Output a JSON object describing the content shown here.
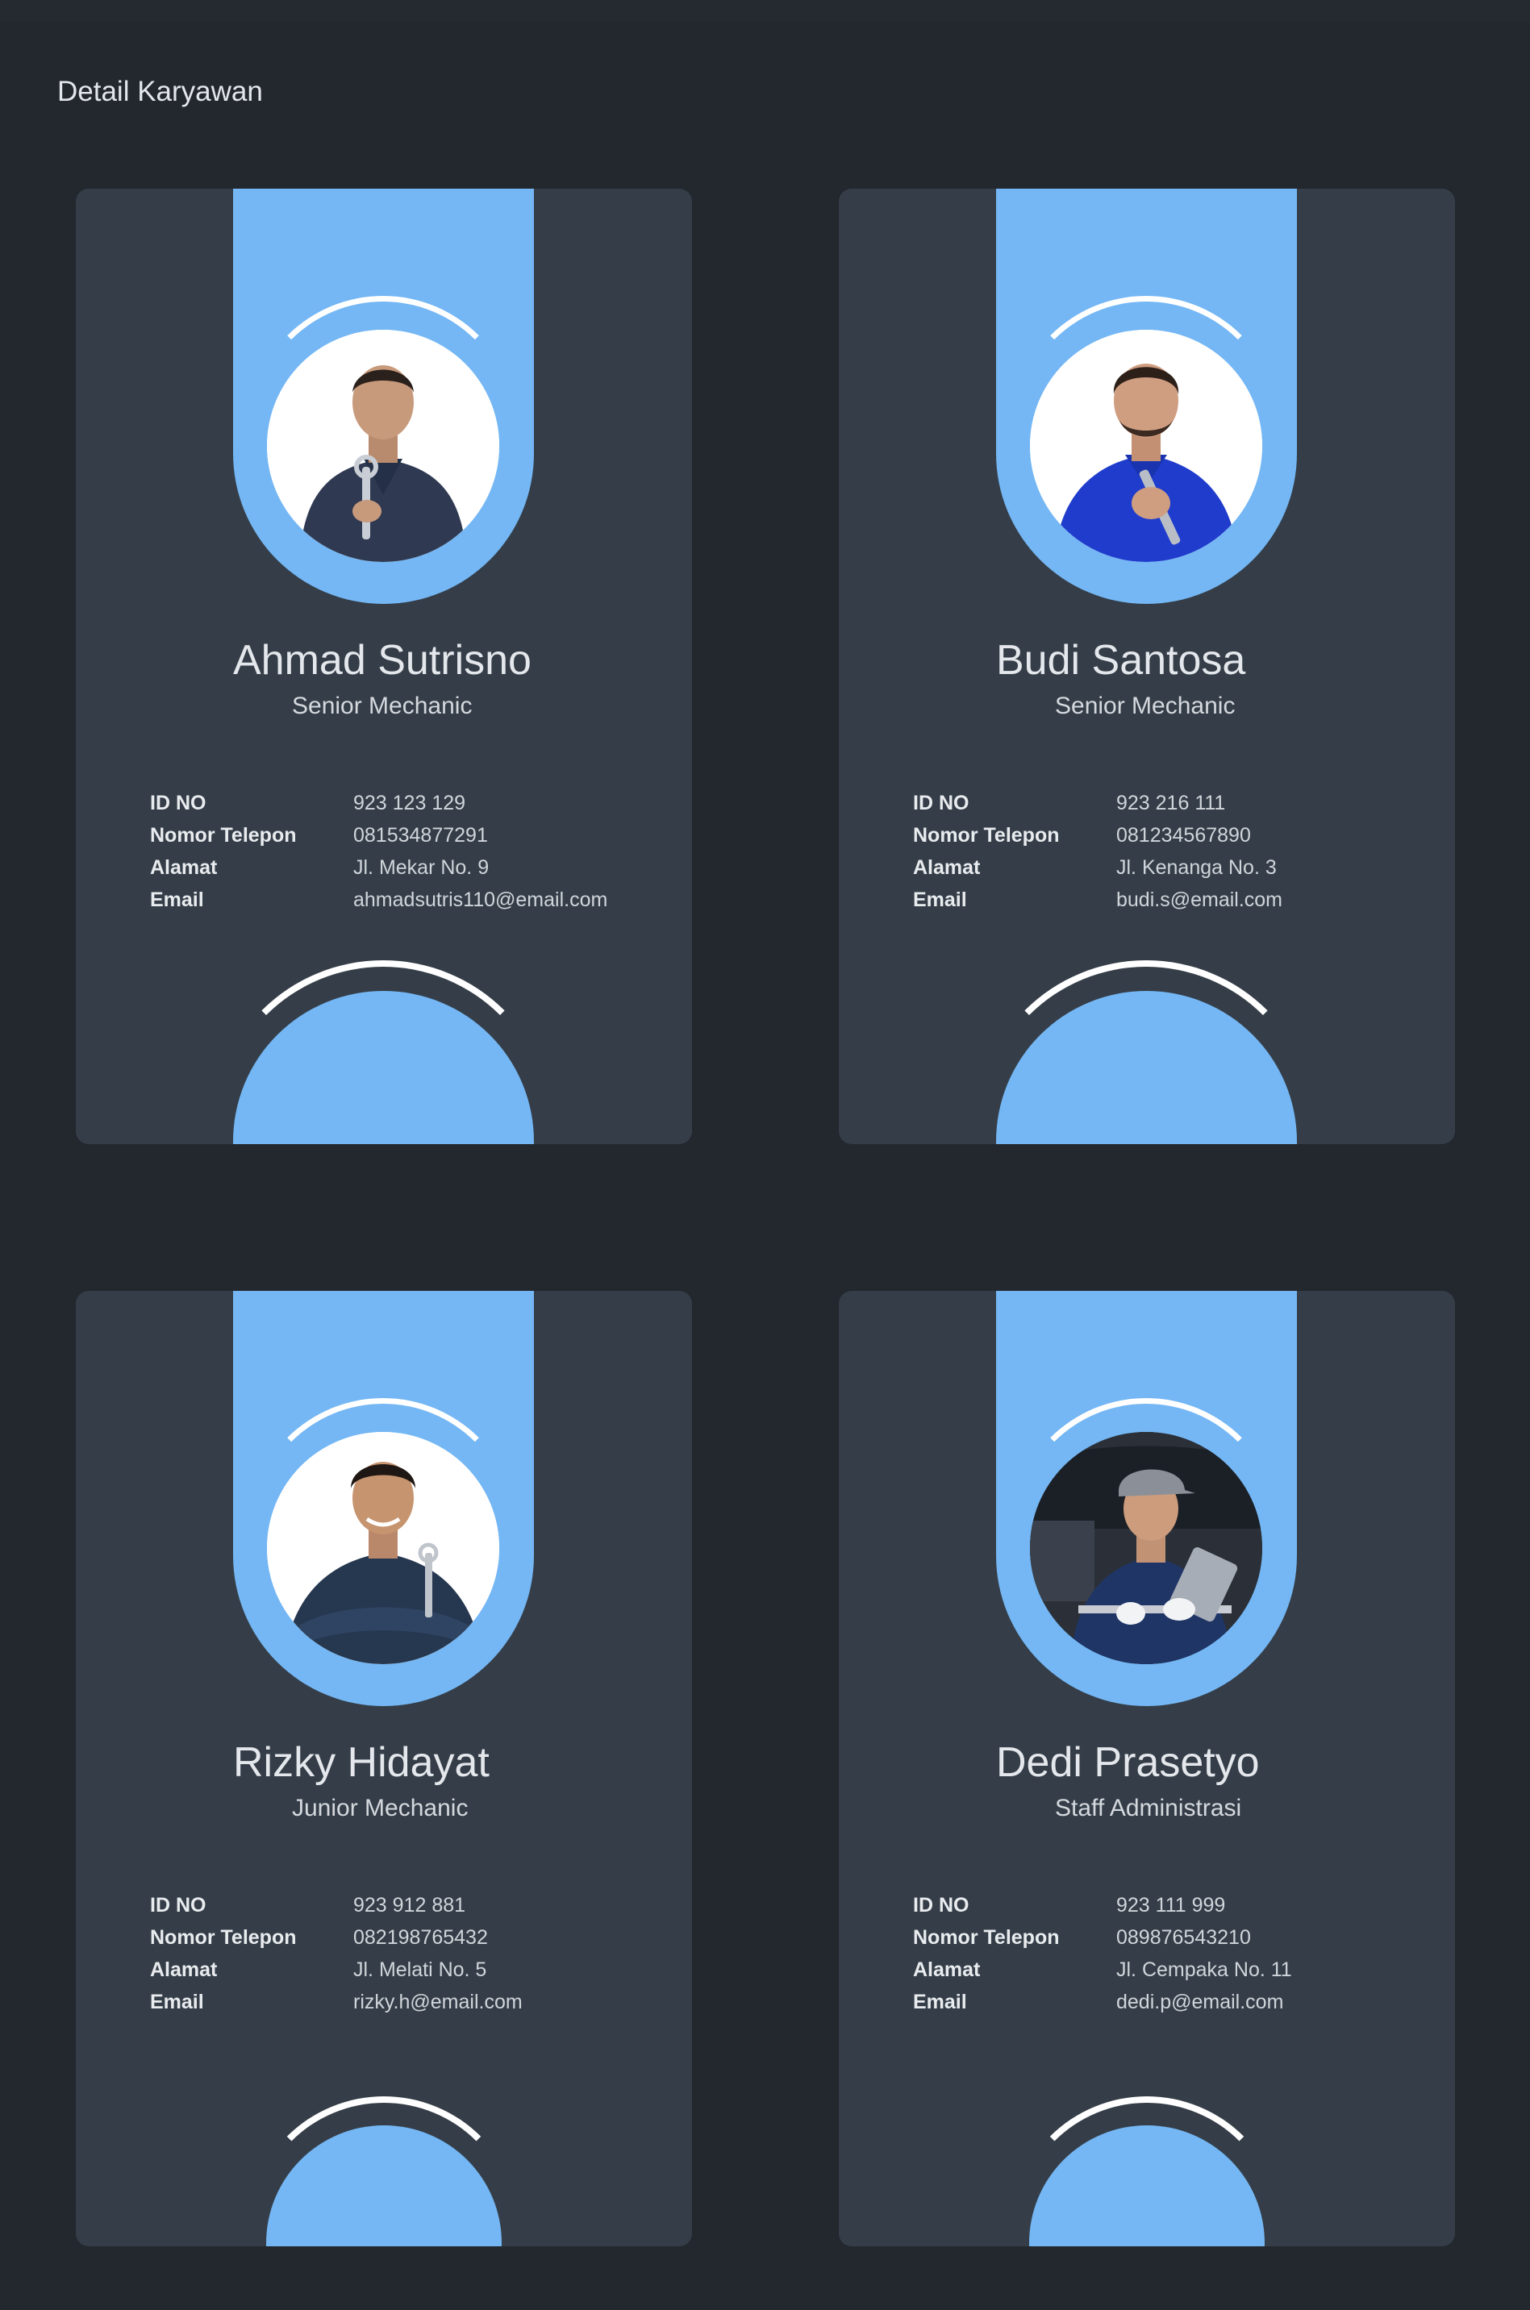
{
  "page": {
    "title": "Detail Karyawan"
  },
  "colors": {
    "background": "#23272e",
    "card": "#353e48",
    "accent": "#74b7f4",
    "arc": "#ffffff"
  },
  "labels": {
    "id": "ID NO",
    "phone": "Nomor Telepon",
    "address": "Alamat",
    "email": "Email"
  },
  "employees": [
    {
      "name": "Ahmad Sutrisno",
      "role": "Senior Mechanic",
      "id": "923 123 129",
      "phone": "081534877291",
      "address": "Jl. Mekar No. 9",
      "email": "ahmadsutris110@email.com",
      "photo_icon": "mechanic-holding-wrench-photo"
    },
    {
      "name": "Budi Santosa",
      "role": "Senior Mechanic",
      "id": "923 216 111",
      "phone": "081234567890",
      "address": "Jl. Kenanga No. 3",
      "email": "budi.s@email.com",
      "photo_icon": "mechanic-blue-shirt-photo"
    },
    {
      "name": "Rizky Hidayat",
      "role": "Junior Mechanic",
      "id": "923 912 881",
      "phone": "082198765432",
      "address": "Jl. Melati No. 5",
      "email": "rizky.h@email.com",
      "photo_icon": "mechanic-arms-crossed-photo"
    },
    {
      "name": "Dedi Prasetyo",
      "role": "Staff Administrasi",
      "id": "923 111 999",
      "phone": "089876543210",
      "address": "Jl. Cempaka No. 11",
      "email": "dedi.p@email.com",
      "photo_icon": "worker-with-tablet-photo"
    }
  ]
}
